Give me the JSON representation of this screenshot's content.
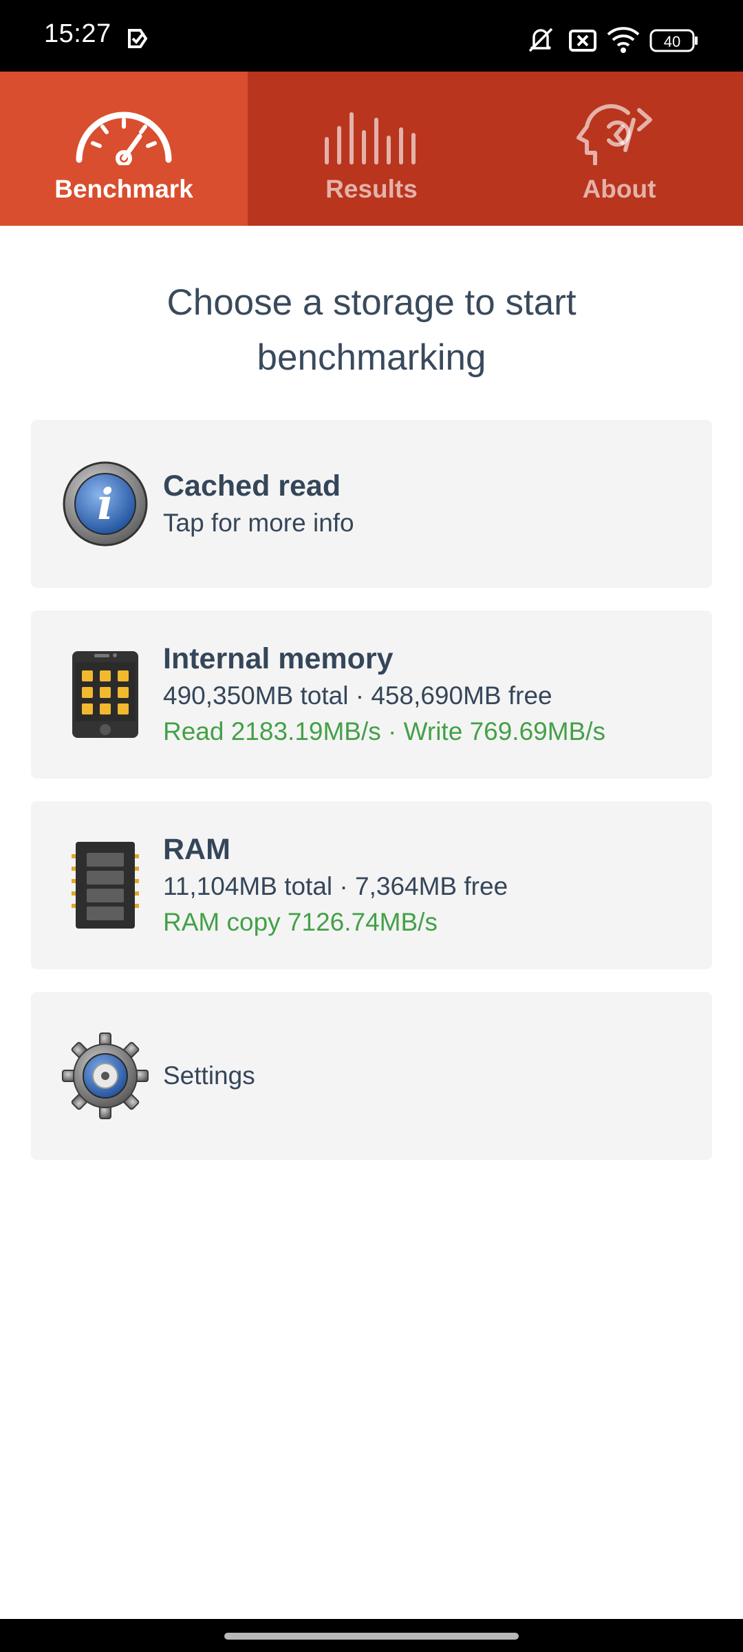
{
  "status_bar": {
    "time": "15:27",
    "battery": "40",
    "icons": [
      "notification-check-icon",
      "mute-icon",
      "close-box-icon",
      "wifi-icon",
      "battery-icon"
    ]
  },
  "tabs": [
    {
      "label": "Benchmark",
      "icon": "speedometer-icon",
      "active": true
    },
    {
      "label": "Results",
      "icon": "bars-icon",
      "active": false
    },
    {
      "label": "About",
      "icon": "head-code-icon",
      "active": false
    }
  ],
  "headline": "Choose a storage to start benchmarking",
  "cards": {
    "cached_read": {
      "title": "Cached read",
      "subtitle": "Tap for more info",
      "icon": "info-icon"
    },
    "internal_memory": {
      "title": "Internal memory",
      "capacity": "490,350MB total · 458,690MB free",
      "speed": "Read 2183.19MB/s · Write 769.69MB/s",
      "icon": "phone-icon"
    },
    "ram": {
      "title": "RAM",
      "capacity": "11,104MB total · 7,364MB free",
      "speed": "RAM copy 7126.74MB/s",
      "icon": "ram-chip-icon"
    },
    "settings": {
      "label": "Settings",
      "icon": "gear-icon"
    }
  },
  "colors": {
    "tab_bar": "#b9351e",
    "tab_active": "#d94e2e",
    "speed_green": "#43a047",
    "text_dark": "#35465a"
  }
}
